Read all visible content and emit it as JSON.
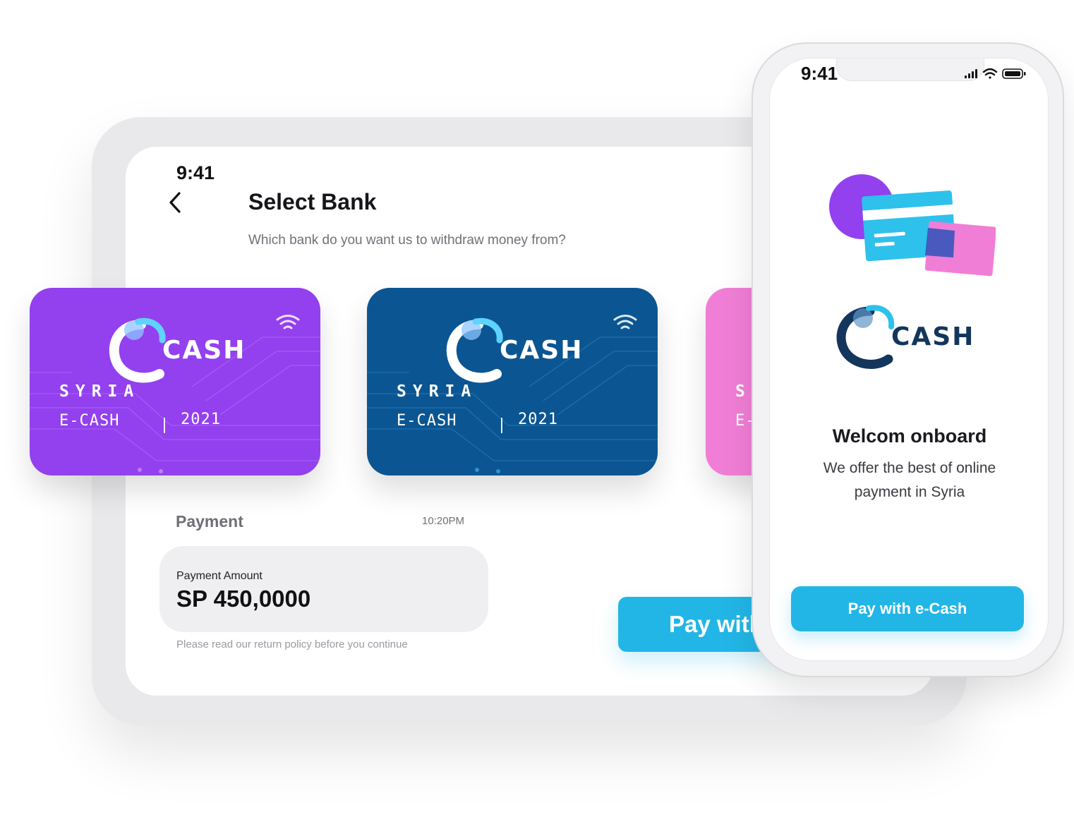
{
  "tablet": {
    "time": "9:41",
    "title": "Select Bank",
    "subtitle": "Which bank do you want us to withdraw money from?",
    "cards": [
      {
        "country": "SYRIA",
        "brand": "E-CASH",
        "year": "2021",
        "logo_text": "CASH",
        "color": "#9340ef"
      },
      {
        "country": "SYRIA",
        "brand": "E-CASH",
        "year": "2021",
        "logo_text": "CASH",
        "color": "#0b5692"
      },
      {
        "country": "S",
        "brand": "E-",
        "color": "#f07ed6"
      }
    ],
    "payment_label": "Payment",
    "payment_time": "10:20PM",
    "amount_caption": "Payment Amount",
    "amount_value": "SP 450,0000",
    "policy": "Please read our return policy before you continue",
    "pay_button": "Pay with e-Cash"
  },
  "phone": {
    "time": "9:41",
    "logo_text": "CASH",
    "title": "Welcom onboard",
    "description": "We offer the best of online payment in Syria",
    "button": "Pay with e-Cash"
  },
  "colors": {
    "accent": "#22b6e6",
    "purple": "#9340ef",
    "navy": "#0b5692",
    "pink": "#f07ed6"
  },
  "icons": [
    "back-chevron-icon",
    "contactless-icon",
    "signal-icon",
    "wifi-icon",
    "battery-icon"
  ]
}
